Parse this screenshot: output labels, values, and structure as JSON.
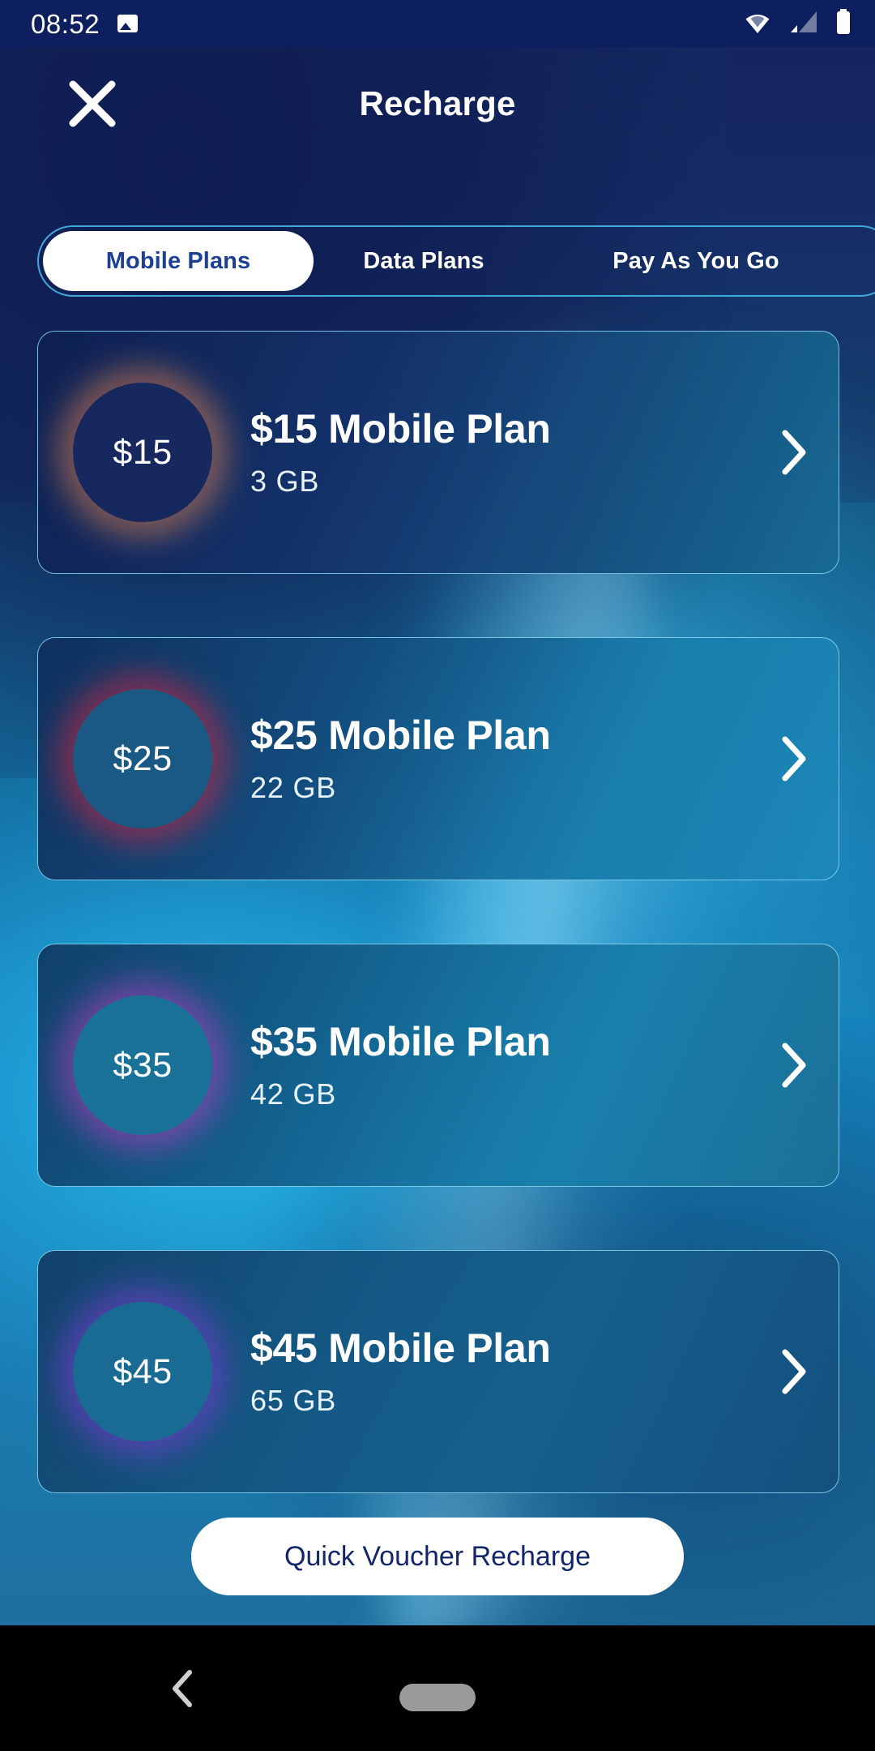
{
  "status_bar": {
    "time": "08:52",
    "icons": [
      "image-icon",
      "wifi-icon",
      "cellular-signal-icon",
      "battery-icon"
    ]
  },
  "header": {
    "title": "Recharge",
    "close_icon": "close-icon"
  },
  "tabs": {
    "selected_index": 0,
    "items": [
      {
        "label": "Mobile Plans"
      },
      {
        "label": "Data Plans"
      },
      {
        "label": "Pay As You Go"
      }
    ]
  },
  "plans": [
    {
      "badge": "$15",
      "title": "$15 Mobile Plan",
      "data": "3 GB",
      "glow_color": "#f08a52",
      "chevron_icon": "chevron-right-icon"
    },
    {
      "badge": "$25",
      "title": "$25 Mobile Plan",
      "data": "22 GB",
      "glow_color": "#e8243f",
      "chevron_icon": "chevron-right-icon"
    },
    {
      "badge": "$35",
      "title": "$35 Mobile Plan",
      "data": "42 GB",
      "glow_color": "#c43ec8",
      "chevron_icon": "chevron-right-icon"
    },
    {
      "badge": "$45",
      "title": "$45 Mobile Plan",
      "data": "65 GB",
      "glow_color": "#8b3ae0",
      "chevron_icon": "chevron-right-icon"
    }
  ],
  "voucher_button": {
    "label": "Quick Voucher Recharge"
  },
  "nav_bar": {
    "back_icon": "back-chevron-icon",
    "home_icon": "home-pill-icon"
  },
  "colors": {
    "status_bar_bg": "#0d1f5e",
    "tab_border": "#3fa9d8",
    "tab_active_text": "#1d3f94",
    "card_border": "#8ad6f2",
    "button_text": "#14266b"
  }
}
